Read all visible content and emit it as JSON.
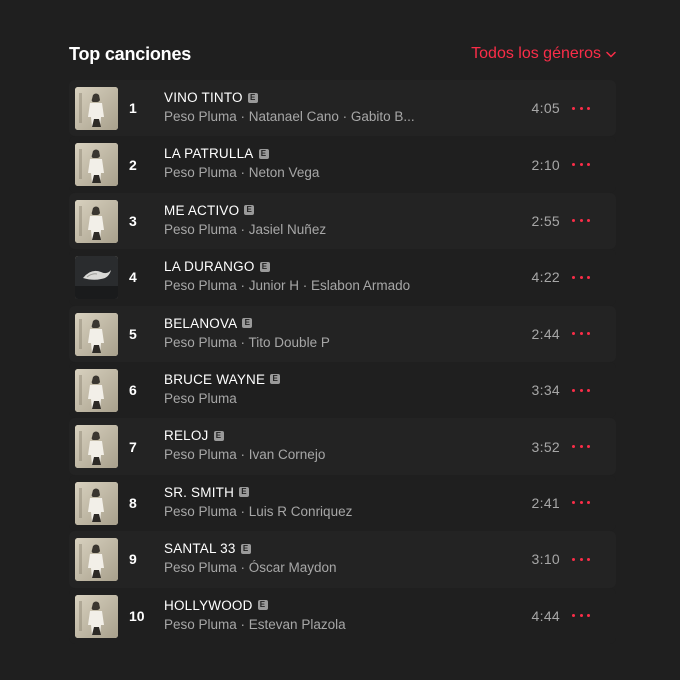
{
  "header": {
    "title": "Top canciones",
    "genre_filter": "Todos los géneros"
  },
  "colors": {
    "accent": "#fa2d48",
    "background": "#1f1f1f",
    "row_alt": "#232323",
    "secondary_text": "#a7a7a7"
  },
  "explicit_badge": "E",
  "songs": [
    {
      "rank": "1",
      "title": "VINO TINTO",
      "artists": "Peso Pluma · Natanael Cano · Gabito B...",
      "duration": "4:05",
      "art": "beige"
    },
    {
      "rank": "2",
      "title": "LA PATRULLA",
      "artists": "Peso Pluma · Neton Vega",
      "duration": "2:10",
      "art": "beige"
    },
    {
      "rank": "3",
      "title": "ME ACTIVO",
      "artists": "Peso Pluma · Jasiel Nuñez",
      "duration": "2:55",
      "art": "beige"
    },
    {
      "rank": "4",
      "title": "LA DURANGO",
      "artists": "Peso Pluma · Junior H · Eslabon Armado",
      "duration": "4:22",
      "art": "dark"
    },
    {
      "rank": "5",
      "title": "BELANOVA",
      "artists": "Peso Pluma · Tito Double P",
      "duration": "2:44",
      "art": "beige"
    },
    {
      "rank": "6",
      "title": "BRUCE WAYNE",
      "artists": "Peso Pluma",
      "duration": "3:34",
      "art": "beige"
    },
    {
      "rank": "7",
      "title": "RELOJ",
      "artists": "Peso Pluma · Ivan Cornejo",
      "duration": "3:52",
      "art": "beige"
    },
    {
      "rank": "8",
      "title": "SR. SMITH",
      "artists": "Peso Pluma · Luis R Conriquez",
      "duration": "2:41",
      "art": "beige"
    },
    {
      "rank": "9",
      "title": "SANTAL 33",
      "artists": "Peso Pluma · Óscar Maydon",
      "duration": "3:10",
      "art": "beige"
    },
    {
      "rank": "10",
      "title": "HOLLYWOOD",
      "artists": "Peso Pluma · Estevan Plazola",
      "duration": "4:44",
      "art": "beige"
    }
  ]
}
